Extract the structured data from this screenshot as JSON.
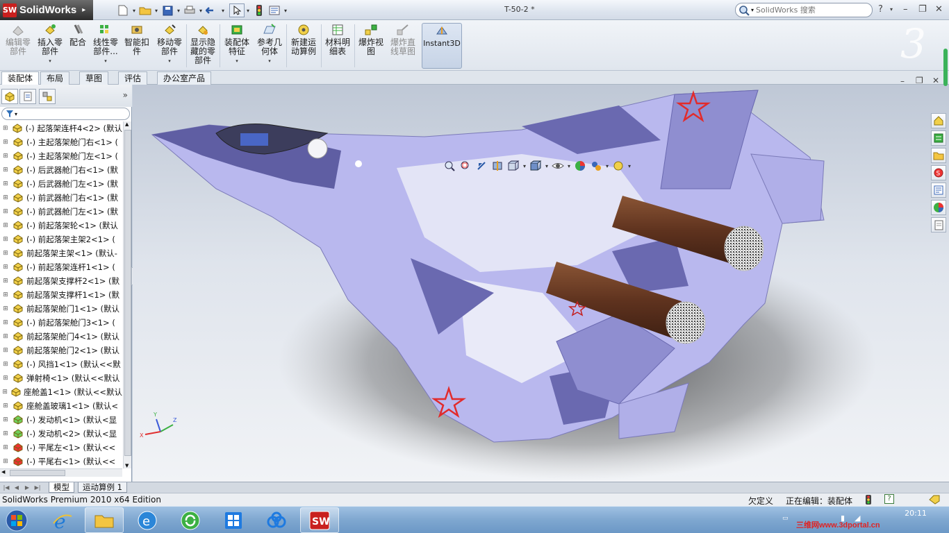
{
  "app": {
    "brand": "SolidWorks",
    "document_title": "T-50-2 *",
    "search_placeholder": "SolidWorks 搜索",
    "help_label": "?"
  },
  "ribbon": {
    "buttons": [
      {
        "label": "编辑零部件",
        "icon": "edit-component-icon",
        "enabled": false
      },
      {
        "label": "插入零部件",
        "icon": "insert-components-icon",
        "enabled": true
      },
      {
        "label": "配合",
        "icon": "mate-icon",
        "enabled": true
      },
      {
        "label": "线性零部件...",
        "icon": "linear-pattern-icon",
        "enabled": true
      },
      {
        "label": "智能扣件",
        "icon": "smart-fasteners-icon",
        "enabled": true
      },
      {
        "label": "移动零部件",
        "icon": "move-component-icon",
        "enabled": true
      },
      {
        "label": "显示隐藏的零部件",
        "icon": "show-hidden-icon",
        "enabled": true
      },
      {
        "label": "装配体特征",
        "icon": "assembly-features-icon",
        "enabled": true
      },
      {
        "label": "参考几何体",
        "icon": "reference-geometry-icon",
        "enabled": true
      },
      {
        "label": "新建运动算例",
        "icon": "new-motion-study-icon",
        "enabled": true
      },
      {
        "label": "材料明细表",
        "icon": "bill-of-materials-icon",
        "enabled": true
      },
      {
        "label": "爆炸视图",
        "icon": "exploded-view-icon",
        "enabled": true
      },
      {
        "label": "爆炸直线草图",
        "icon": "explode-line-sketch-icon",
        "enabled": false
      },
      {
        "label": "Instant3D",
        "icon": "instant3d-icon",
        "enabled": true
      }
    ]
  },
  "command_tabs": [
    "装配体",
    "布局",
    "草图",
    "评估",
    "办公室产品"
  ],
  "tree": {
    "filter_label": "▾",
    "items": [
      "(-) 起落架连杆4<2> (默认",
      "(-) 主起落架舱门右<1> (",
      "(-) 主起落架舱门左<1> (",
      "(-) 后武器舱门右<1> (默",
      "(-) 后武器舱门左<1> (默",
      "(-) 前武器舱门右<1> (默",
      "(-) 前武器舱门左<1> (默",
      "(-) 前起落架轮<1> (默认",
      "(-) 前起落架主架2<1> (",
      "前起落架主架<1> (默认-",
      "(-) 前起落架连杆1<1> (",
      "前起落架支撑杆2<1> (默",
      "前起落架支撑杆1<1> (默",
      "前起落架舱门1<1> (默认",
      "(-) 前起落架舱门3<1> (",
      "前起落架舱门4<1> (默认",
      "前起落架舱门2<1> (默认",
      "(-) 风挡1<1> (默认<<默",
      "弹射椅<1> (默认<<默认",
      "座舱盖1<1> (默认<<默认",
      "座舱盖玻璃1<1> (默认<",
      "(-) 发动机<1> (默认<显",
      "(-) 发动机<2> (默认<显",
      "(-) 平尾左<1> (默认<<",
      "(-) 平尾右<1> (默认<<"
    ]
  },
  "bottom_tabs": [
    "模型",
    "运动算例 1"
  ],
  "status": {
    "edition": "SolidWorks Premium 2010 x64 Edition",
    "under_defined": "欠定义",
    "editing": "正在编辑：装配体"
  },
  "taskbar": {
    "apps": [
      "internet-explorer",
      "file-explorer",
      "ie-blue",
      "sync-green",
      "metro-tiles",
      "baidu-cloud",
      "solidworks"
    ],
    "time": "20:11",
    "watermark": "三维网www.3dportal.cn"
  },
  "colors": {
    "airframe": "#b9b8ee",
    "airframe_dark": "#6a69b0",
    "airframe_light": "#e3e4f6",
    "engine_nozzle": "#6b3a26",
    "star_red": "#e22b2b",
    "brand_red": "#c9201e"
  }
}
